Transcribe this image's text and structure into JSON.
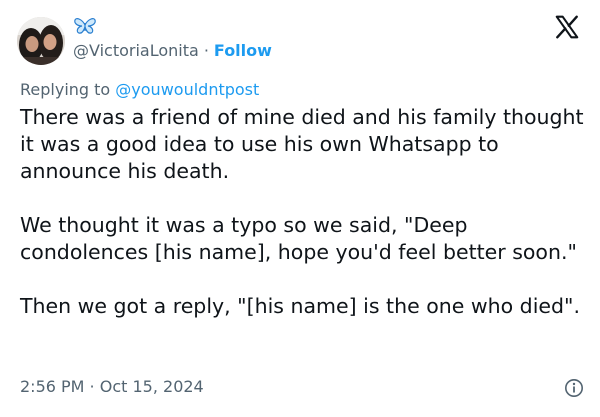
{
  "author": {
    "handle": "@VictoriaLonita",
    "separator": "·",
    "follow_label": "Follow",
    "avatar_icon": "profile-avatar",
    "badge_icon": "butterfly-icon",
    "follow_color": "#1d9bf0"
  },
  "reply": {
    "prefix": "Replying to",
    "mention": "@youwouldntpost"
  },
  "tweet": {
    "paragraphs": [
      "There was a friend of mine died and his family thought it was a good idea to use his own Whatsapp to announce his death.",
      "We thought it was a typo so we said, \"Deep condolences [his name], hope you'd feel better soon.\"",
      "Then we got a reply, \"[his name] is the one who died\"."
    ]
  },
  "meta": {
    "timestamp": "2:56 PM · Oct 15, 2024",
    "info_icon": "info-icon"
  },
  "brand": {
    "logo_icon": "x-logo-icon"
  }
}
